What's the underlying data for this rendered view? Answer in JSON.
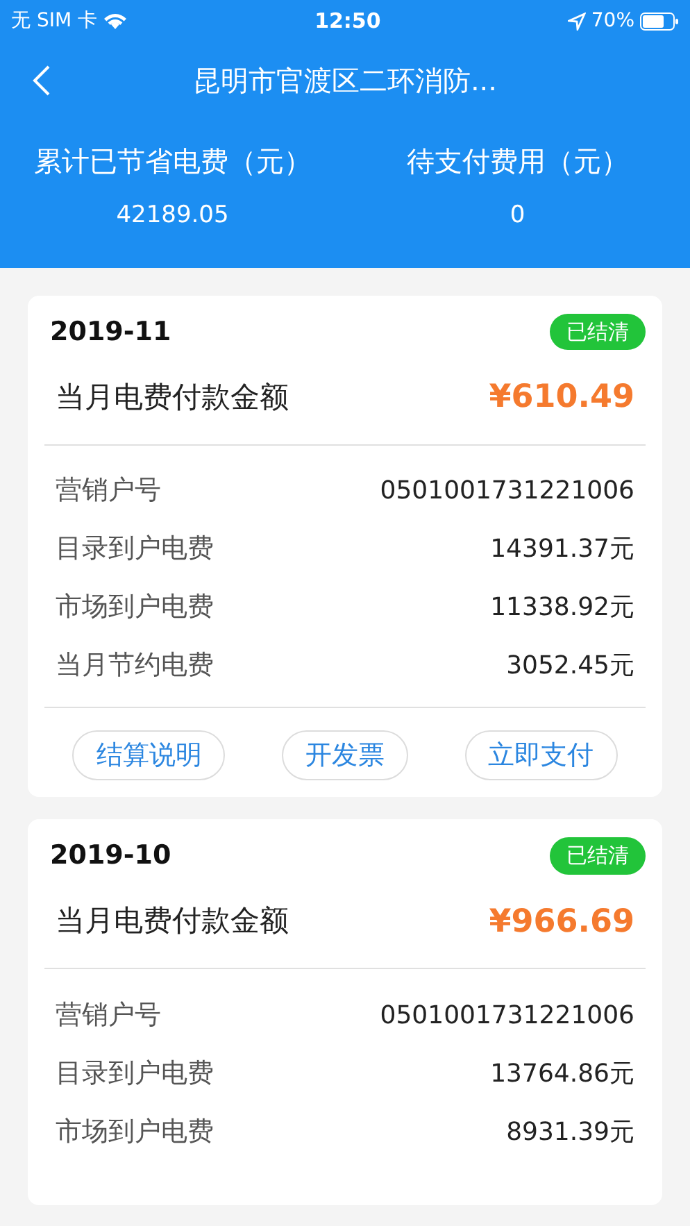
{
  "status_bar": {
    "carrier": "无 SIM 卡",
    "time": "12:50",
    "battery": "70%"
  },
  "nav": {
    "title": "昆明市官渡区二环消防..."
  },
  "summary": [
    {
      "label": "累计已节省电费（元）",
      "value": "42189.05"
    },
    {
      "label": "待支付费用（元）",
      "value": "0"
    }
  ],
  "bills": [
    {
      "month": "2019-11",
      "status": {
        "text": "已结清",
        "kind": "settled"
      },
      "amount_label": "当月电费付款金额",
      "amount": "¥610.49",
      "details": [
        {
          "label": "营销户号",
          "value": "0501001731221006"
        },
        {
          "label": "目录到户电费",
          "value": "14391.37元"
        },
        {
          "label": "市场到户电费",
          "value": "11338.92元"
        },
        {
          "label": "当月节约电费",
          "value": "3052.45元"
        }
      ],
      "buttons": [
        "结算说明",
        "开发票",
        "立即支付"
      ]
    },
    {
      "month": "2019-10",
      "status": {
        "text": "已结清",
        "kind": "settled"
      },
      "amount_label": "当月电费付款金额",
      "amount": "¥966.69",
      "details": [
        {
          "label": "营销户号",
          "value": "0501001731221006"
        },
        {
          "label": "目录到户电费",
          "value": "13764.86元"
        },
        {
          "label": "市场到户电费",
          "value": "8931.39元"
        }
      ]
    }
  ]
}
